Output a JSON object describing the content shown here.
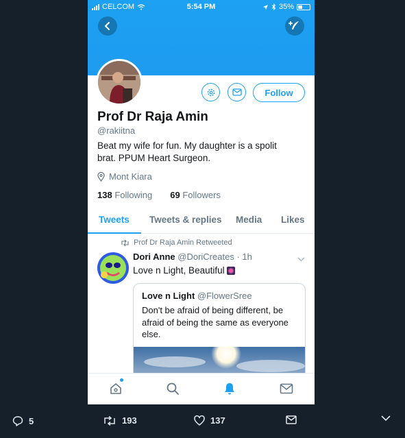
{
  "status_bar": {
    "carrier": "CELCOM",
    "time": "5:54 PM",
    "battery": "35%"
  },
  "profile": {
    "name": "Prof Dr Raja Amin",
    "handle": "@rakiitna",
    "bio": "Beat my wife for fun. My daughter is a spolit brat. PPUM Heart Surgeon.",
    "location": "Mont Kiara",
    "following_count": "138",
    "following_label": "Following",
    "followers_count": "69",
    "followers_label": "Followers",
    "follow_button": "Follow"
  },
  "tabs": [
    "Tweets",
    "Tweets & replies",
    "Media",
    "Likes"
  ],
  "tweet": {
    "retweet_label": "Prof Dr Raja Amin Retweeted",
    "author_name": "Dori Anne",
    "author_handle": "@DoriCreates",
    "time": "· 1h",
    "text": "Love n Light, Beautiful",
    "quote": {
      "author_name": "Love n Light",
      "author_handle": "@FlowerSree",
      "text": "Don't be afraid of being different, be afraid of being the same as everyone else."
    }
  },
  "actions": {
    "replies": "5",
    "retweets": "193",
    "likes": "137"
  },
  "colors": {
    "accent": "#1da1f2",
    "background": "#15202b"
  }
}
